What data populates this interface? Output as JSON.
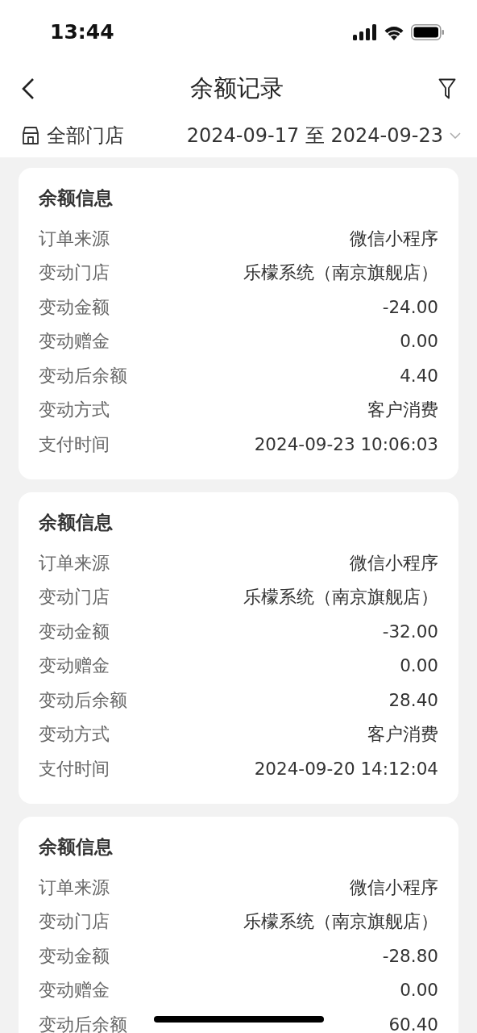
{
  "status_bar": {
    "time": "13:44"
  },
  "header": {
    "title": "余额记录"
  },
  "filter": {
    "store": "全部门店",
    "date_range": "2024-09-17 至 2024-09-23"
  },
  "records": [
    {
      "title": "余额信息",
      "rows": [
        {
          "label": "订单来源",
          "value": "微信小程序"
        },
        {
          "label": "变动门店",
          "value": "乐檬系统（南京旗舰店）"
        },
        {
          "label": "变动金额",
          "value": "-24.00"
        },
        {
          "label": "变动赠金",
          "value": "0.00"
        },
        {
          "label": "变动后余额",
          "value": "4.40"
        },
        {
          "label": "变动方式",
          "value": "客户消费"
        },
        {
          "label": "支付时间",
          "value": "2024-09-23 10:06:03"
        }
      ]
    },
    {
      "title": "余额信息",
      "rows": [
        {
          "label": "订单来源",
          "value": "微信小程序"
        },
        {
          "label": "变动门店",
          "value": "乐檬系统（南京旗舰店）"
        },
        {
          "label": "变动金额",
          "value": "-32.00"
        },
        {
          "label": "变动赠金",
          "value": "0.00"
        },
        {
          "label": "变动后余额",
          "value": "28.40"
        },
        {
          "label": "变动方式",
          "value": "客户消费"
        },
        {
          "label": "支付时间",
          "value": "2024-09-20 14:12:04"
        }
      ]
    },
    {
      "title": "余额信息",
      "rows": [
        {
          "label": "订单来源",
          "value": "微信小程序"
        },
        {
          "label": "变动门店",
          "value": "乐檬系统（南京旗舰店）"
        },
        {
          "label": "变动金额",
          "value": "-28.80"
        },
        {
          "label": "变动赠金",
          "value": "0.00"
        },
        {
          "label": "变动后余额",
          "value": "60.40"
        }
      ]
    }
  ]
}
